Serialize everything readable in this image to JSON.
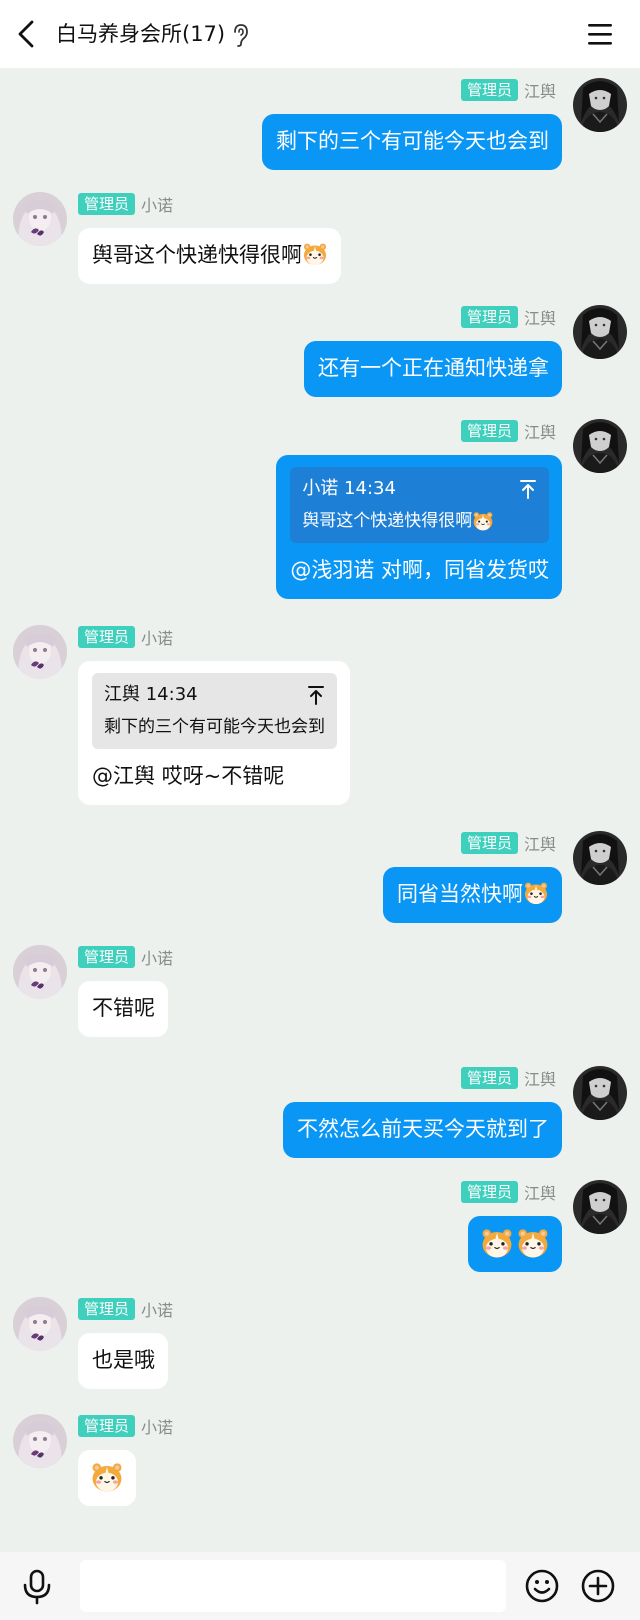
{
  "header": {
    "title": "白马养身会所(17)",
    "icons": [
      "back-arrow-icon",
      "ear-icon",
      "menu-icon"
    ]
  },
  "colors": {
    "accent": "#0996f5",
    "badge": "#3fcfbd",
    "background": "#edf1ee"
  },
  "messages": [
    {
      "side": "right",
      "badge": "管理员",
      "sender": "江舆",
      "text": "剩下的三个有可能今天也会到"
    },
    {
      "side": "left",
      "badge": "管理员",
      "sender": "小诺",
      "text": "舆哥这个快递快得很啊",
      "emoji": "hamster-emoji"
    },
    {
      "side": "right",
      "badge": "管理员",
      "sender": "江舆",
      "text": "还有一个正在通知快递拿"
    },
    {
      "side": "right",
      "badge": "管理员",
      "sender": "江舆",
      "quote": {
        "author": "小诺",
        "time": "14:34",
        "text": "舆哥这个快递快得很啊",
        "emoji": "hamster-emoji"
      },
      "text": "@浅羽诺 对啊，同省发货哎"
    },
    {
      "side": "left",
      "badge": "管理员",
      "sender": "小诺",
      "quote": {
        "author": "江舆",
        "time": "14:34",
        "text": "剩下的三个有可能今天也会到"
      },
      "text": "@江舆 哎呀~不错呢"
    },
    {
      "side": "right",
      "badge": "管理员",
      "sender": "江舆",
      "text": "同省当然快啊",
      "emoji": "hamster-emoji"
    },
    {
      "side": "left",
      "badge": "管理员",
      "sender": "小诺",
      "text": "不错呢"
    },
    {
      "side": "right",
      "badge": "管理员",
      "sender": "江舆",
      "text": "不然怎么前天买今天就到了"
    },
    {
      "side": "right",
      "badge": "管理员",
      "sender": "江舆",
      "emojis": [
        "hamster-emoji",
        "hamster-emoji"
      ]
    },
    {
      "side": "left",
      "badge": "管理员",
      "sender": "小诺",
      "text": "也是哦"
    },
    {
      "side": "left",
      "badge": "管理员",
      "sender": "小诺",
      "emojis": [
        "hamster-emoji"
      ]
    }
  ],
  "input": {
    "value": "",
    "icons": [
      "microphone-icon",
      "smiley-icon",
      "plus-circle-icon"
    ]
  }
}
